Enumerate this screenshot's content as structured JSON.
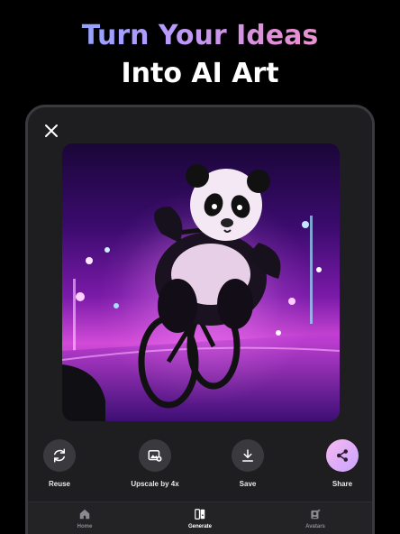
{
  "headline": {
    "line1": "Turn Your Ideas",
    "line2": "Into AI Art"
  },
  "viewer": {
    "close_icon": "close-icon",
    "image_alt": "panda-riding-bmx-neon-city"
  },
  "actions": [
    {
      "label": "Reuse",
      "icon": "refresh-icon"
    },
    {
      "label": "Upscale by 4x",
      "icon": "upscale-image-icon"
    },
    {
      "label": "Save",
      "icon": "download-icon"
    },
    {
      "label": "Share",
      "icon": "share-icon"
    }
  ],
  "tabs": [
    {
      "label": "Home",
      "icon": "home-icon",
      "active": false
    },
    {
      "label": "Generate",
      "icon": "generate-icon",
      "active": true
    },
    {
      "label": "Avatars",
      "icon": "avatars-icon",
      "active": false
    }
  ],
  "colors": {
    "background": "#000000",
    "panel": "#1e1e20",
    "button": "#3a3a3e",
    "share_gradient_start": "#f6b9ef",
    "share_gradient_end": "#c9a3ff",
    "headline_gradient_start": "#6fa8ff",
    "headline_gradient_end": "#f09ac3"
  }
}
